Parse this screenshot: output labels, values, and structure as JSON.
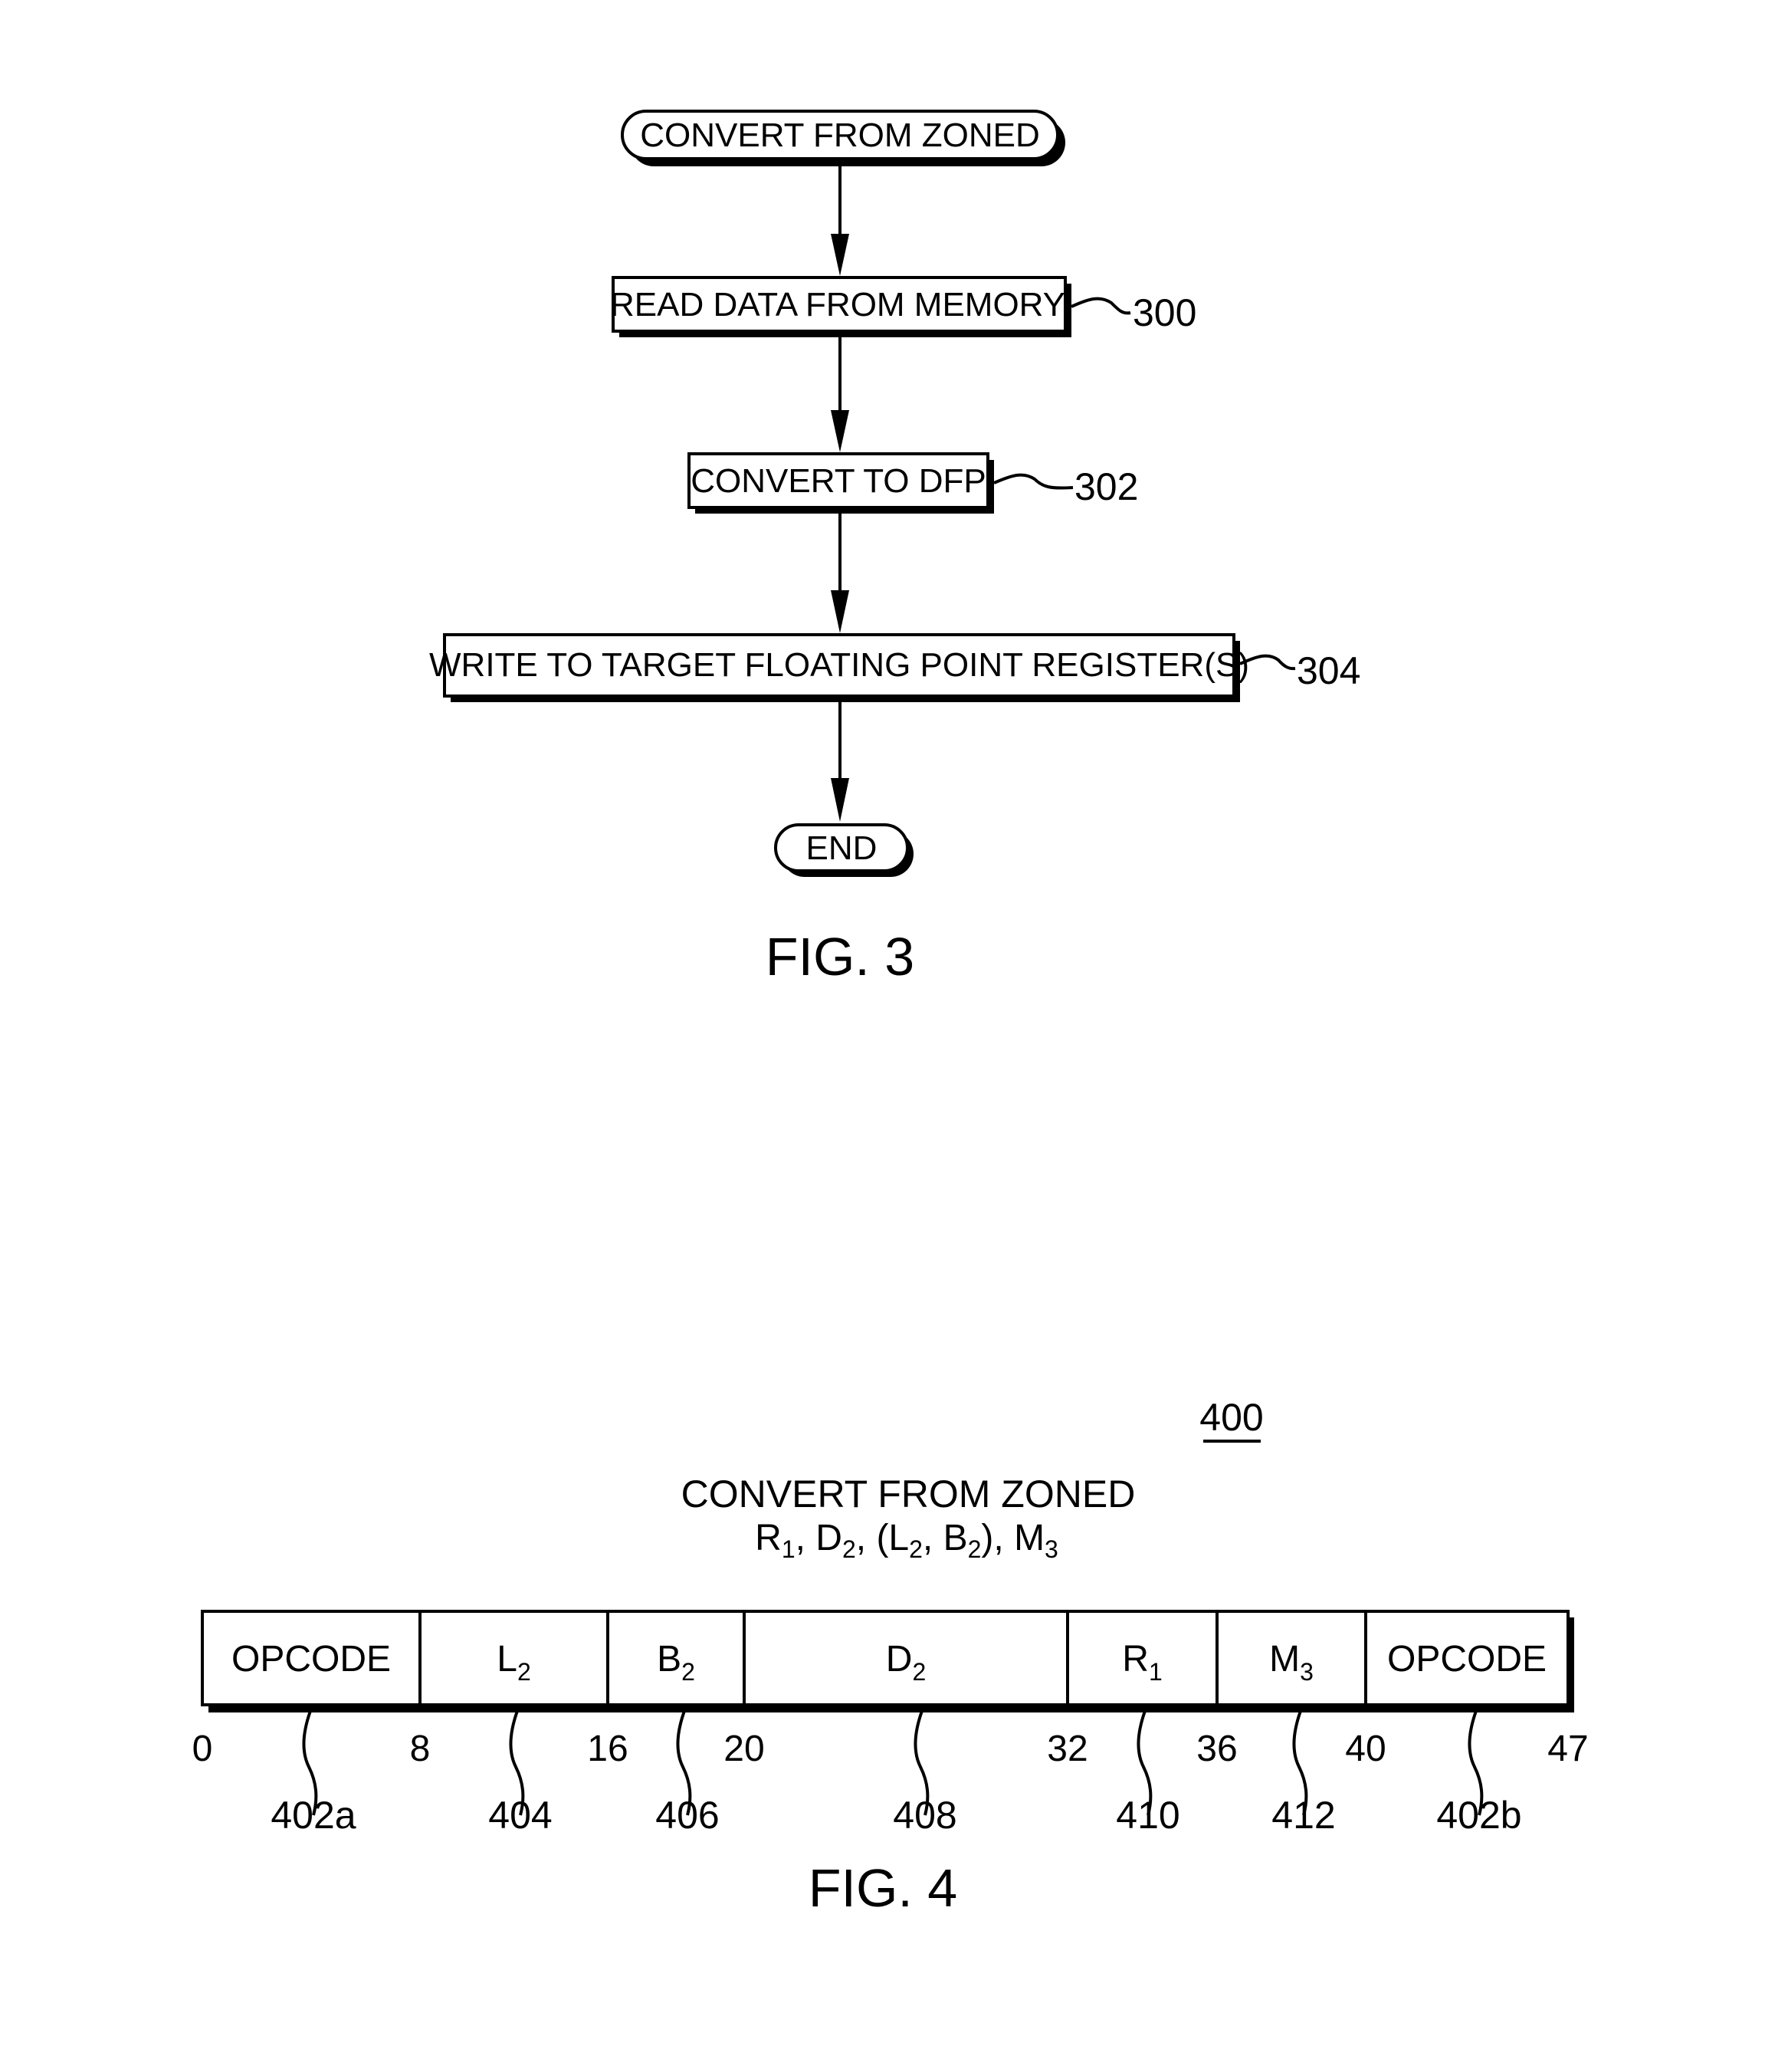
{
  "fig3": {
    "start": "CONVERT FROM ZONED",
    "steps": [
      {
        "label": "READ DATA FROM MEMORY",
        "ref": "300"
      },
      {
        "label": "CONVERT TO DFP",
        "ref": "302"
      },
      {
        "label": "WRITE TO TARGET FLOATING POINT REGISTER(S)",
        "ref": "304"
      }
    ],
    "end": "END",
    "caption": "FIG. 3"
  },
  "fig4": {
    "ref": "400",
    "title": "CONVERT FROM ZONED",
    "operands": {
      "r": "R",
      "r_sub": "1",
      "d": "D",
      "d_sub": "2",
      "l": "L",
      "l_sub": "2",
      "b": "B",
      "b_sub": "2",
      "m": "M",
      "m_sub": "3"
    },
    "fields": [
      {
        "label": "OPCODE",
        "sub": "",
        "ref": "402a"
      },
      {
        "label": "L",
        "sub": "2",
        "ref": "404"
      },
      {
        "label": "B",
        "sub": "2",
        "ref": "406"
      },
      {
        "label": "D",
        "sub": "2",
        "ref": "408"
      },
      {
        "label": "R",
        "sub": "1",
        "ref": "410"
      },
      {
        "label": "M",
        "sub": "3",
        "ref": "412"
      },
      {
        "label": "OPCODE",
        "sub": "",
        "ref": "402b"
      }
    ],
    "bits": [
      "0",
      "8",
      "16",
      "20",
      "32",
      "36",
      "40",
      "47"
    ],
    "caption": "FIG. 4"
  }
}
